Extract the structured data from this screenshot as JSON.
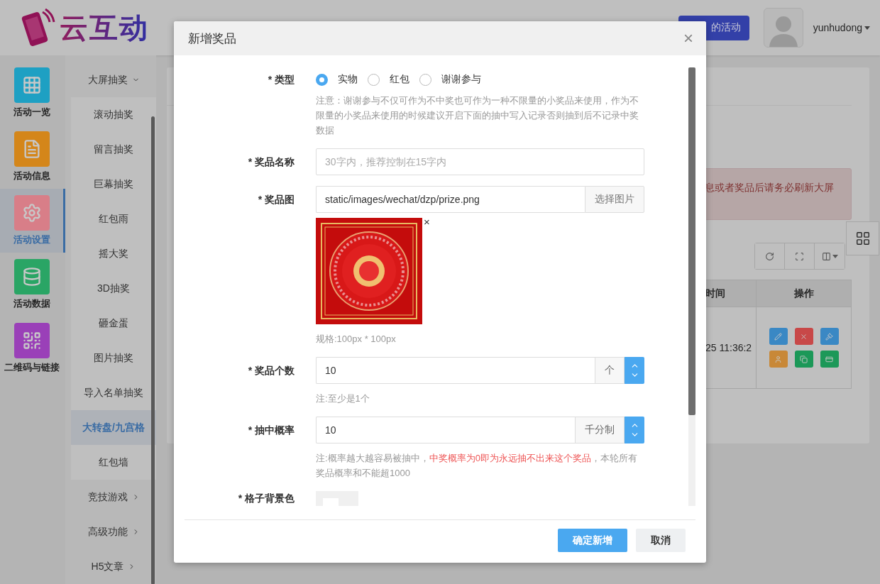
{
  "header": {
    "logo": "云互动",
    "activities_button": "的活动",
    "username": "yunhudong"
  },
  "nav": [
    {
      "label": "活动一览",
      "kind": "grid",
      "color": "#1ea0c3",
      "selected": false
    },
    {
      "label": "活动信息",
      "kind": "document",
      "color": "#d4861a",
      "selected": false
    },
    {
      "label": "活动设置",
      "kind": "gear",
      "color": "#d87e88",
      "selected": true
    },
    {
      "label": "活动数据",
      "kind": "database",
      "color": "#2aa565",
      "selected": false
    },
    {
      "label": "二维码与链接",
      "kind": "qrcode",
      "color": "#9a40b8",
      "selected": false
    }
  ],
  "submenu": [
    {
      "label": "大屏抽奖",
      "expanded": true,
      "children": [
        {
          "label": "滚动抽奖",
          "selected": false
        },
        {
          "label": "留言抽奖",
          "selected": false
        },
        {
          "label": "巨幕抽奖",
          "selected": false
        },
        {
          "label": "红包雨",
          "selected": false
        },
        {
          "label": "摇大奖",
          "selected": false
        },
        {
          "label": "3D抽奖",
          "selected": false
        },
        {
          "label": "砸金蛋",
          "selected": false
        },
        {
          "label": "图片抽奖",
          "selected": false
        },
        {
          "label": "导入名单抽奖",
          "selected": false
        },
        {
          "label": "大转盘/九宫格",
          "selected": true
        },
        {
          "label": "红包墙",
          "selected": false
        }
      ]
    },
    {
      "label": "竞技游戏",
      "expanded": false
    },
    {
      "label": "高级功能",
      "expanded": false
    },
    {
      "label": "H5文章",
      "expanded": false
    }
  ],
  "main": {
    "alert": "息或者奖品后请务必刷新大屏",
    "tools": [
      {
        "kind": "refresh"
      },
      {
        "kind": "fullscreen"
      },
      {
        "kind": "columns"
      }
    ],
    "table": {
      "columns": [
        "时间",
        "操作"
      ],
      "rows": [
        {
          "time": "25 11:36:2",
          "actions": [
            {
              "kind": "edit",
              "color": "#3a88c4"
            },
            {
              "kind": "delete",
              "color": "#c84848"
            },
            {
              "kind": "gavel",
              "color": "#3a88c4"
            },
            {
              "kind": "user",
              "color": "#c88838"
            },
            {
              "kind": "copy",
              "color": "#1c9858"
            },
            {
              "kind": "card",
              "color": "#1c9858"
            }
          ]
        }
      ]
    }
  },
  "modal": {
    "title": "新增奖品",
    "close": "×",
    "fields": [
      {
        "kind": "radio",
        "label": "* 类型",
        "options": [
          {
            "label": "实物",
            "selected": true
          },
          {
            "label": "红包",
            "selected": false
          },
          {
            "label": "谢谢参与",
            "selected": false
          }
        ],
        "note": [
          {
            "text": "注意：谢谢参与不仅可作为不中奖也可作为一种不限量的小奖品来使用，作为不限量的小奖品来使用的时候建议开启下面的抽中写入记录否则抽到后不记录中奖数据",
            "warning": false
          }
        ]
      },
      {
        "kind": "text",
        "label": "* 奖品名称",
        "placeholder": "30字内，推荐控制在15字内"
      },
      {
        "label": "* 奖品图",
        "value": "static/images/wechat/dzp/prize.png",
        "button": "选择图片",
        "remove": "×",
        "note": [
          {
            "text": "规格:100px * 100px",
            "warning": false
          }
        ]
      },
      {
        "kind": "number",
        "label": "* 奖品个数",
        "value": "10",
        "unit": "个",
        "note": [
          {
            "text": "注:至少是1个",
            "warning": false
          }
        ]
      },
      {
        "kind": "number",
        "label": "* 抽中概率",
        "value": "10",
        "unit": "千分制",
        "note": [
          {
            "text": "注:概率越大越容易被抽中，",
            "warning": false
          },
          {
            "text": "中奖概率为0即为永远抽不出来这个奖品",
            "warning": true
          },
          {
            "text": "，本轮所有奖品概率和不能超1000",
            "warning": false
          }
        ]
      },
      {
        "kind": "color",
        "label": "* 格子背景色"
      }
    ],
    "buttons": [
      {
        "label": "确定新增",
        "kind": "primary"
      },
      {
        "label": "取消",
        "kind": "default"
      }
    ]
  }
}
